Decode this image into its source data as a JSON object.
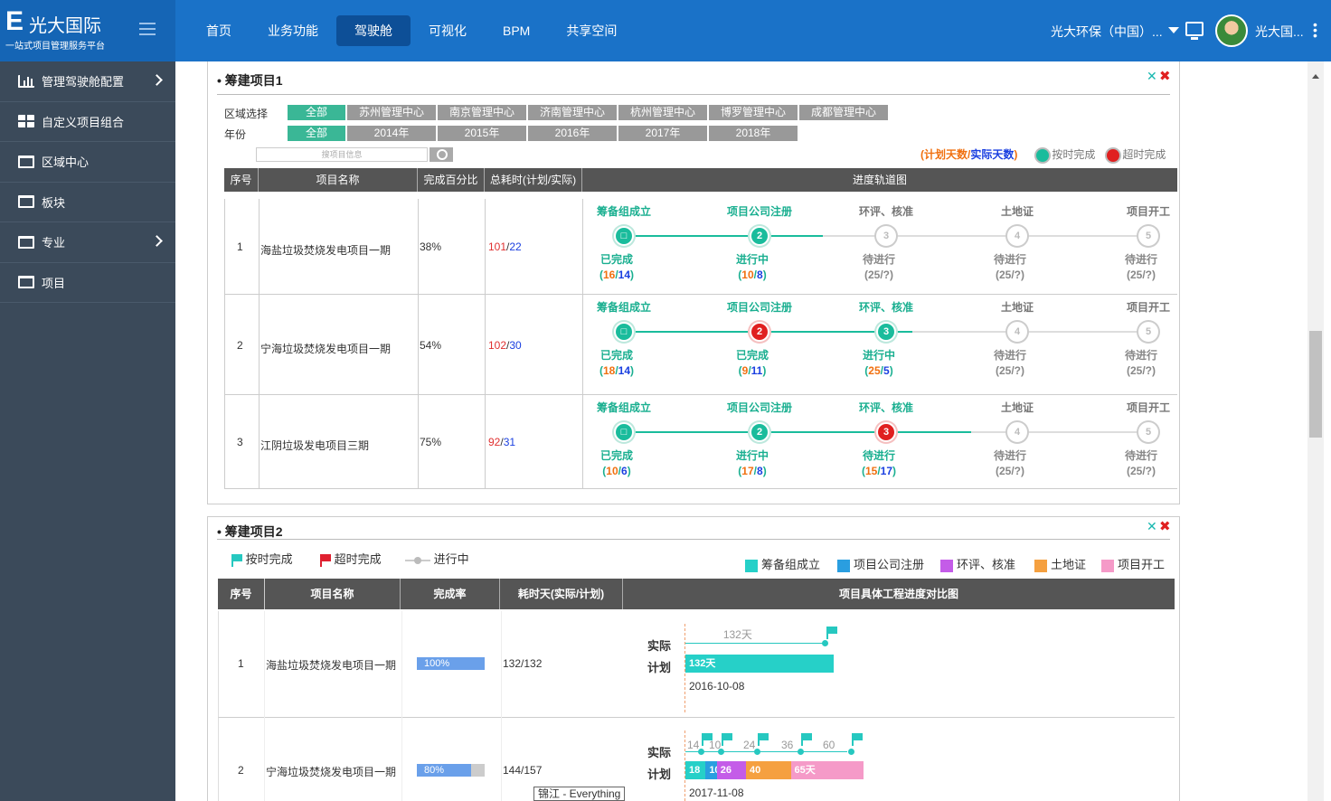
{
  "app": {
    "title": "光大国际",
    "subtitle": "一站式项目管理服务平台",
    "org": "光大环保（中国）...",
    "user": "光大国..."
  },
  "nav": [
    "首页",
    "业务功能",
    "驾驶舱",
    "可视化",
    "BPM",
    "共享空间"
  ],
  "sidebar": [
    {
      "label": "管理驾驶舱配置",
      "icon": "bar-chart-icon",
      "arrow": true
    },
    {
      "label": "自定义项目组合",
      "icon": "grid-icon",
      "arrow": false
    },
    {
      "label": "区域中心",
      "icon": "folder-icon",
      "arrow": false
    },
    {
      "label": "板块",
      "icon": "folder-icon",
      "arrow": false
    },
    {
      "label": "专业",
      "icon": "folder-icon",
      "arrow": true
    },
    {
      "label": "项目",
      "icon": "folder-icon",
      "arrow": false
    }
  ],
  "panel1": {
    "title": "筹建项目1",
    "region_label": "区域选择",
    "year_label": "年份",
    "regions": [
      "全部",
      "苏州管理中心",
      "南京管理中心",
      "济南管理中心",
      "杭州管理中心",
      "博罗管理中心",
      "成都管理中心"
    ],
    "years": [
      "全部",
      "2014年",
      "2015年",
      "2016年",
      "2017年",
      "2018年"
    ],
    "search_placeholder": "搜项目信息",
    "legend_paren_open": "(",
    "legend_plan": "计划天数",
    "legend_slash": "/",
    "legend_actual": "实际天数",
    "legend_paren_close": ")",
    "legend_ontime": "按时完成",
    "legend_overtime": "超时完成",
    "headers": [
      "序号",
      "项目名称",
      "完成百分比",
      "总耗时(计划/实际)",
      "进度轨道图"
    ],
    "steps": [
      "筹备组成立",
      "项目公司注册",
      "环评、核准",
      "土地证",
      "项目开工"
    ],
    "rows": [
      {
        "no": "1",
        "name": "海盐垃圾焚烧发电项目一期",
        "pct": "38%",
        "plan": "101",
        "sep": "/",
        "actual": "22",
        "nodes": [
          {
            "label": "□",
            "state": "done",
            "status": "已完成",
            "p": "16",
            "a": "14"
          },
          {
            "label": "2",
            "state": "doing",
            "status": "进行中",
            "p": "10",
            "a": "8"
          },
          {
            "label": "3",
            "state": "todo",
            "status": "待进行",
            "p": "25",
            "a": "?"
          },
          {
            "label": "4",
            "state": "todo",
            "status": "待进行",
            "p": "25",
            "a": "?"
          },
          {
            "label": "5",
            "state": "todo",
            "status": "待进行",
            "p": "25",
            "a": "?"
          }
        ],
        "progress_to": 1.5
      },
      {
        "no": "2",
        "name": "宁海垃圾焚烧发电项目一期",
        "pct": "54%",
        "plan": "102",
        "sep": "/",
        "actual": "30",
        "nodes": [
          {
            "label": "□",
            "state": "done",
            "status": "已完成",
            "p": "18",
            "a": "14"
          },
          {
            "label": "2",
            "state": "over",
            "status": "已完成",
            "p": "9",
            "a": "11"
          },
          {
            "label": "3",
            "state": "doing",
            "status": "进行中",
            "p": "25",
            "a": "5"
          },
          {
            "label": "4",
            "state": "todo",
            "status": "待进行",
            "p": "25",
            "a": "?"
          },
          {
            "label": "5",
            "state": "todo",
            "status": "待进行",
            "p": "25",
            "a": "?"
          }
        ],
        "progress_to": 2.2
      },
      {
        "no": "3",
        "name": "江阴垃圾发电项目三期",
        "pct": "75%",
        "plan": "92",
        "sep": "/",
        "actual": "31",
        "nodes": [
          {
            "label": "□",
            "state": "done",
            "status": "已完成",
            "p": "10",
            "a": "6"
          },
          {
            "label": "2",
            "state": "doing",
            "status": "进行中",
            "p": "17",
            "a": "8"
          },
          {
            "label": "3",
            "state": "over",
            "status": "待进行",
            "p": "15",
            "a": "17"
          },
          {
            "label": "4",
            "state": "todo",
            "status": "待进行",
            "p": "25",
            "a": "?"
          },
          {
            "label": "5",
            "state": "todo",
            "status": "待进行",
            "p": "25",
            "a": "?"
          }
        ],
        "progress_to": 2.65
      }
    ]
  },
  "panel2": {
    "title": "筹建项目2",
    "legend_ontime": "按时完成",
    "legend_overtime": "超时完成",
    "legend_doing": "进行中",
    "phases": [
      {
        "name": "筹备组成立",
        "color": "#26d0c8"
      },
      {
        "name": "项目公司注册",
        "color": "#2a9ee0"
      },
      {
        "name": "环评、核准",
        "color": "#c45ce8"
      },
      {
        "name": "土地证",
        "color": "#f5a040"
      },
      {
        "name": "项目开工",
        "color": "#f59ac8"
      }
    ],
    "headers": [
      "序号",
      "项目名称",
      "完成率",
      "耗时天(实际/计划)",
      "项目具体工程进度对比图"
    ],
    "actual_label": "实际",
    "plan_label": "计划",
    "rows": [
      {
        "no": "1",
        "name": "海盐垃圾焚烧发电项目一期",
        "rate": "100%",
        "rate_value": 1.0,
        "days": "132/132",
        "actual_text": "132天",
        "plan_segments": [
          {
            "label": "132天",
            "value": 132,
            "phase": 0
          }
        ],
        "date": "2016-10-08"
      },
      {
        "no": "2",
        "name": "宁海垃圾焚烧发电项目一期",
        "rate": "80%",
        "rate_value": 0.8,
        "days": "144/157",
        "actual_marks": [
          "14",
          "10",
          "24",
          "36",
          "60"
        ],
        "plan_segments": [
          {
            "label": "18",
            "value": 18,
            "phase": 0
          },
          {
            "label": "10",
            "value": 10,
            "phase": 1
          },
          {
            "label": "26",
            "value": 26,
            "phase": 2
          },
          {
            "label": "40",
            "value": 40,
            "phase": 3
          },
          {
            "label": "65天",
            "value": 65,
            "phase": 4
          }
        ],
        "date": "2017-11-08"
      }
    ]
  },
  "tooltip": "锦江 - Everything",
  "colors": {
    "ontime": "#1abc9c",
    "overtime": "#e02020",
    "track": "#1abc9c",
    "todo": "#cccccc"
  }
}
